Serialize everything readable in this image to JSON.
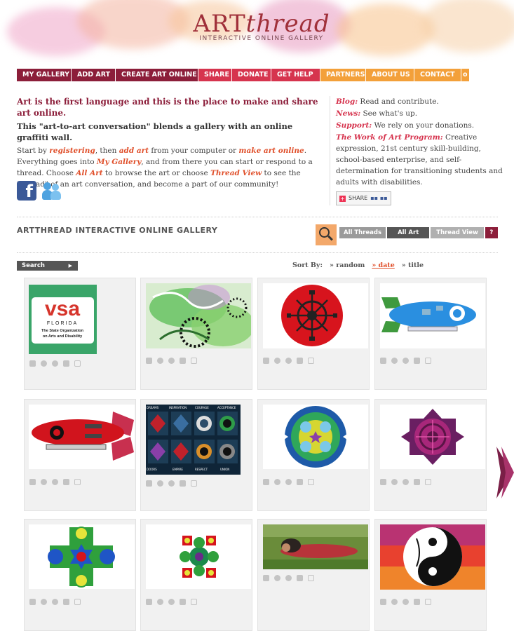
{
  "brand": {
    "logo_art": "ART",
    "logo_thread": "thread",
    "logo_sub": "INTERACTIVE ONLINE GALLERY",
    "colors": {
      "brand": "#8c1e3a",
      "accent": "#d6344e",
      "highlight": "#e04f2a",
      "partner": "#f3a03a"
    }
  },
  "nav": {
    "items": [
      {
        "label": "MY GALLERY"
      },
      {
        "label": "ADD ART"
      },
      {
        "label": "CREATE ART ONLINE"
      },
      {
        "label": "SHARE"
      },
      {
        "label": "DONATE"
      },
      {
        "label": "GET HELP"
      },
      {
        "label": "PARTNERS"
      },
      {
        "label": "ABOUT US"
      },
      {
        "label": "CONTACT"
      },
      {
        "label": "o"
      }
    ]
  },
  "intro": {
    "headline": "Art is the first language and this is the place to make and share art online.",
    "subhead": "This \"art-to-art conversation\" blends a gallery with an online graffiti wall.",
    "p_start": "Start by ",
    "registering": "registering",
    "p_then": ", then ",
    "add_art": "add art",
    "p_from": " from your computer or ",
    "make_art_online": "make art online",
    "p_everything": ". Everything goes into ",
    "my_gallery": "My Gallery",
    "p_thread": ", and from there you can start or respond to a thread. Choose ",
    "all_art": "All Art",
    "p_browse": " to browse the art or choose ",
    "thread_view": "Thread View",
    "p_end": " to see the \"thread\" of an art conversation, and become a part of our community!"
  },
  "sidebar": {
    "blog_label": "Blog:",
    "blog_text": " Read and contribute.",
    "news_label": "News:",
    "news_text": " See what's up.",
    "support_label": "Support:",
    "support_text": " We rely on your donations.",
    "program_label": "The Work of Art Program:",
    "program_text": " Creative expression, 21st century skill-building, school-based enterprise, and self-determination for transitioning students and adults with disabilities.",
    "share_label": "SHARE"
  },
  "gallery": {
    "title": "ARTTHREAD INTERACTIVE ONLINE GALLERY",
    "views": [
      "All Threads",
      "All Art",
      "Thread View"
    ],
    "help": "?",
    "search_label": "Search",
    "sort_by": "Sort By:",
    "sort_random": "» random",
    "sort_date": "» date",
    "sort_title": "» title",
    "vsa_big": "vsa",
    "vsa_state": "FLORIDA",
    "vsa_line1": "The State Organization",
    "vsa_line2": "on Arts and Disability",
    "tile_labels": [
      "DREAMS",
      "INSPIRATION",
      "COURAGE",
      "ACCEPTANCE",
      "DOORS",
      "EMPIRE",
      "RESPECT",
      "UNION"
    ],
    "items": [
      {
        "icon": "vsa-logo"
      },
      {
        "icon": "green-swirl-art"
      },
      {
        "icon": "red-wheel-circle"
      },
      {
        "icon": "blue-airship"
      },
      {
        "icon": "red-airship"
      },
      {
        "icon": "tiles-grid-art"
      },
      {
        "icon": "blue-green-mandala"
      },
      {
        "icon": "purple-star-mandala"
      },
      {
        "icon": "green-cross-mandala"
      },
      {
        "icon": "flower-square-pattern"
      },
      {
        "icon": "woman-on-grass-photo"
      },
      {
        "icon": "yin-yang-art"
      }
    ]
  }
}
